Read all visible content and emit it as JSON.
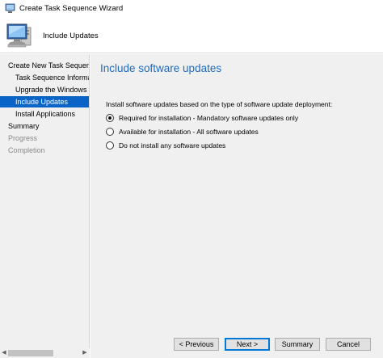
{
  "window": {
    "title": "Create Task Sequence Wizard",
    "icon": "wizard-computer-icon"
  },
  "header": {
    "title": "Include Updates",
    "icon": "computer-monitor-icon"
  },
  "sidebar": {
    "items": [
      {
        "label": "Create New Task Sequence",
        "state": "normal"
      },
      {
        "label": "Task Sequence Informati",
        "state": "normal"
      },
      {
        "label": "Upgrade the Windows Op",
        "state": "normal"
      },
      {
        "label": "Include Updates",
        "state": "selected"
      },
      {
        "label": "Install Applications",
        "state": "normal"
      },
      {
        "label": "Summary",
        "state": "normal"
      },
      {
        "label": "Progress",
        "state": "disabled"
      },
      {
        "label": "Completion",
        "state": "disabled"
      }
    ]
  },
  "main": {
    "heading": "Include software updates",
    "instruction": "Install software updates based on the type of software update deployment:",
    "options": [
      {
        "label": "Required for installation - Mandatory software updates only",
        "selected": true
      },
      {
        "label": "Available for installation - All software updates",
        "selected": false
      },
      {
        "label": "Do not install any software updates",
        "selected": false
      }
    ]
  },
  "footer": {
    "previous_label": "< Previous",
    "next_label": "Next >",
    "summary_label": "Summary",
    "cancel_label": "Cancel"
  },
  "colors": {
    "accent": "#0a64c8",
    "heading": "#1f6cbf",
    "panel": "#f0f0f0"
  }
}
